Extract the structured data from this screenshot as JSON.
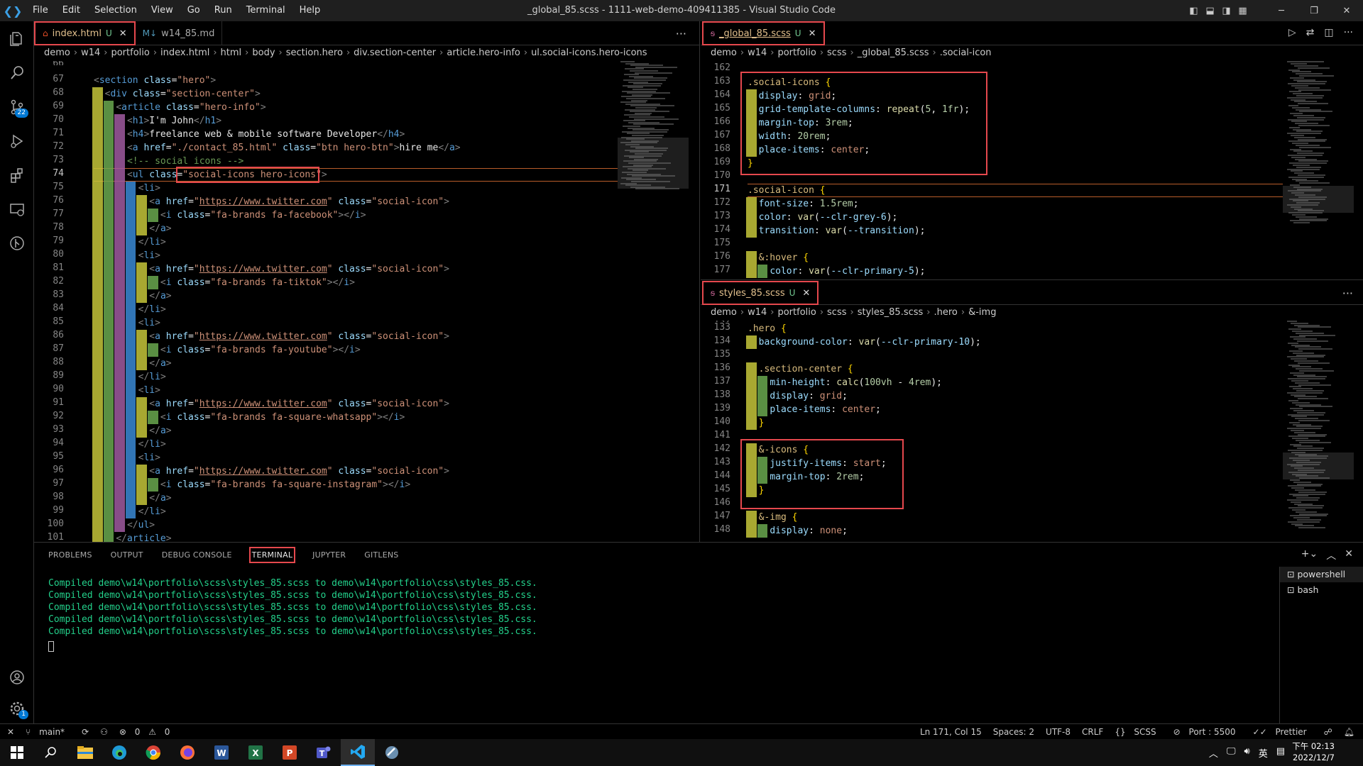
{
  "window": {
    "title": "_global_85.scss - 1111-web-demo-409411385 - Visual Studio Code",
    "menu": [
      "File",
      "Edit",
      "Selection",
      "View",
      "Go",
      "Run",
      "Terminal",
      "Help"
    ]
  },
  "activity_icons": [
    "explorer-icon",
    "search-icon",
    "source-control-icon",
    "run-debug-icon",
    "extensions-icon",
    "remote-explorer-icon",
    "gitlens-icon"
  ],
  "source_control_badge": "22",
  "settings_badge": "1",
  "left_editor": {
    "tabs": [
      {
        "label": "index.html",
        "status": "U",
        "icon": "html-icon",
        "active": true
      },
      {
        "label": "w14_85.md",
        "status": "",
        "icon": "markdown-icon",
        "active": false
      }
    ],
    "breadcrumb": [
      "demo",
      "w14",
      "portfolio",
      "index.html",
      "html",
      "body",
      "section.hero",
      "div.section-center",
      "article.hero-info",
      "ul.social-icons.hero-icons"
    ],
    "first_partial_line": "66",
    "current_line": 74,
    "lines": [
      {
        "n": "67",
        "html": "<span class='pn'>&lt;</span><span class='tag'>section</span> <span class='an'>class</span><span class='tx'>=</span><span class='av'>\"hero\"</span><span class='pn'>&gt;</span>"
      },
      {
        "n": "68",
        "html": "  <span class='pn'>&lt;</span><span class='tag'>div</span> <span class='an'>class</span><span class='tx'>=</span><span class='av'>\"section-center\"</span><span class='pn'>&gt;</span>"
      },
      {
        "n": "69",
        "html": "    <span class='pn'>&lt;</span><span class='tag'>article</span> <span class='an'>class</span><span class='tx'>=</span><span class='av'>\"hero-info\"</span><span class='pn'>&gt;</span>"
      },
      {
        "n": "70",
        "html": "      <span class='pn'>&lt;</span><span class='tag'>h1</span><span class='pn'>&gt;</span><span class='tx'>I'm John</span><span class='pn'>&lt;/</span><span class='tag'>h1</span><span class='pn'>&gt;</span>"
      },
      {
        "n": "71",
        "html": "      <span class='pn'>&lt;</span><span class='tag'>h4</span><span class='pn'>&gt;</span><span class='tx'>freelance web &amp; mobile software Developer</span><span class='pn'>&lt;/</span><span class='tag'>h4</span><span class='pn'>&gt;</span>"
      },
      {
        "n": "72",
        "html": "      <span class='pn'>&lt;</span><span class='tag'>a</span> <span class='an'>href</span><span class='tx'>=</span><span class='av'>\"./contact_85.html\"</span> <span class='an'>class</span><span class='tx'>=</span><span class='av'>\"btn hero-btn\"</span><span class='pn'>&gt;</span><span class='tx'>hire me</span><span class='pn'>&lt;/</span><span class='tag'>a</span><span class='pn'>&gt;</span>"
      },
      {
        "n": "73",
        "html": "      <span class='cm'>&lt;!-- social icons --&gt;</span>"
      },
      {
        "n": "74",
        "html": "      <span class='pn'>&lt;</span><span class='tag'>ul</span> <span class='an'>class</span><span class='tx'>=</span><span class='av'>\"social-icons hero-icons\"</span><span class='pn'>&gt;</span>"
      },
      {
        "n": "75",
        "html": "        <span class='pn'>&lt;</span><span class='tag'>li</span><span class='pn'>&gt;</span>"
      },
      {
        "n": "76",
        "html": "          <span class='pn'>&lt;</span><span class='tag'>a</span> <span class='an'>href</span><span class='tx'>=</span><span class='av'>\"</span><span class='url'>https://www.twitter.com</span><span class='av'>\"</span> <span class='an'>class</span><span class='tx'>=</span><span class='av'>\"social-icon\"</span><span class='pn'>&gt;</span>"
      },
      {
        "n": "77",
        "html": "            <span class='pn'>&lt;</span><span class='tag'>i</span> <span class='an'>class</span><span class='tx'>=</span><span class='av'>\"fa-brands fa-facebook\"</span><span class='pn'>&gt;&lt;/</span><span class='tag'>i</span><span class='pn'>&gt;</span>"
      },
      {
        "n": "78",
        "html": "          <span class='pn'>&lt;/</span><span class='tag'>a</span><span class='pn'>&gt;</span>"
      },
      {
        "n": "79",
        "html": "        <span class='pn'>&lt;/</span><span class='tag'>li</span><span class='pn'>&gt;</span>"
      },
      {
        "n": "80",
        "html": "        <span class='pn'>&lt;</span><span class='tag'>li</span><span class='pn'>&gt;</span>"
      },
      {
        "n": "81",
        "html": "          <span class='pn'>&lt;</span><span class='tag'>a</span> <span class='an'>href</span><span class='tx'>=</span><span class='av'>\"</span><span class='url'>https://www.twitter.com</span><span class='av'>\"</span> <span class='an'>class</span><span class='tx'>=</span><span class='av'>\"social-icon\"</span><span class='pn'>&gt;</span>"
      },
      {
        "n": "82",
        "html": "            <span class='pn'>&lt;</span><span class='tag'>i</span> <span class='an'>class</span><span class='tx'>=</span><span class='av'>\"fa-brands fa-tiktok\"</span><span class='pn'>&gt;&lt;/</span><span class='tag'>i</span><span class='pn'>&gt;</span>"
      },
      {
        "n": "83",
        "html": "          <span class='pn'>&lt;/</span><span class='tag'>a</span><span class='pn'>&gt;</span>"
      },
      {
        "n": "84",
        "html": "        <span class='pn'>&lt;/</span><span class='tag'>li</span><span class='pn'>&gt;</span>"
      },
      {
        "n": "85",
        "html": "        <span class='pn'>&lt;</span><span class='tag'>li</span><span class='pn'>&gt;</span>"
      },
      {
        "n": "86",
        "html": "          <span class='pn'>&lt;</span><span class='tag'>a</span> <span class='an'>href</span><span class='tx'>=</span><span class='av'>\"</span><span class='url'>https://www.twitter.com</span><span class='av'>\"</span> <span class='an'>class</span><span class='tx'>=</span><span class='av'>\"social-icon\"</span><span class='pn'>&gt;</span>"
      },
      {
        "n": "87",
        "html": "            <span class='pn'>&lt;</span><span class='tag'>i</span> <span class='an'>class</span><span class='tx'>=</span><span class='av'>\"fa-brands fa-youtube\"</span><span class='pn'>&gt;&lt;/</span><span class='tag'>i</span><span class='pn'>&gt;</span>"
      },
      {
        "n": "88",
        "html": "          <span class='pn'>&lt;/</span><span class='tag'>a</span><span class='pn'>&gt;</span>"
      },
      {
        "n": "89",
        "html": "        <span class='pn'>&lt;/</span><span class='tag'>li</span><span class='pn'>&gt;</span>"
      },
      {
        "n": "90",
        "html": "        <span class='pn'>&lt;</span><span class='tag'>li</span><span class='pn'>&gt;</span>"
      },
      {
        "n": "91",
        "html": "          <span class='pn'>&lt;</span><span class='tag'>a</span> <span class='an'>href</span><span class='tx'>=</span><span class='av'>\"</span><span class='url'>https://www.twitter.com</span><span class='av'>\"</span> <span class='an'>class</span><span class='tx'>=</span><span class='av'>\"social-icon\"</span><span class='pn'>&gt;</span>"
      },
      {
        "n": "92",
        "html": "            <span class='pn'>&lt;</span><span class='tag'>i</span> <span class='an'>class</span><span class='tx'>=</span><span class='av'>\"fa-brands fa-square-whatsapp\"</span><span class='pn'>&gt;&lt;/</span><span class='tag'>i</span><span class='pn'>&gt;</span>"
      },
      {
        "n": "93",
        "html": "          <span class='pn'>&lt;/</span><span class='tag'>a</span><span class='pn'>&gt;</span>"
      },
      {
        "n": "94",
        "html": "        <span class='pn'>&lt;/</span><span class='tag'>li</span><span class='pn'>&gt;</span>"
      },
      {
        "n": "95",
        "html": "        <span class='pn'>&lt;</span><span class='tag'>li</span><span class='pn'>&gt;</span>"
      },
      {
        "n": "96",
        "html": "          <span class='pn'>&lt;</span><span class='tag'>a</span> <span class='an'>href</span><span class='tx'>=</span><span class='av'>\"</span><span class='url'>https://www.twitter.com</span><span class='av'>\"</span> <span class='an'>class</span><span class='tx'>=</span><span class='av'>\"social-icon\"</span><span class='pn'>&gt;</span>"
      },
      {
        "n": "97",
        "html": "            <span class='pn'>&lt;</span><span class='tag'>i</span> <span class='an'>class</span><span class='tx'>=</span><span class='av'>\"fa-brands fa-square-instagram\"</span><span class='pn'>&gt;&lt;/</span><span class='tag'>i</span><span class='pn'>&gt;</span>"
      },
      {
        "n": "98",
        "html": "          <span class='pn'>&lt;/</span><span class='tag'>a</span><span class='pn'>&gt;</span>"
      },
      {
        "n": "99",
        "html": "        <span class='pn'>&lt;/</span><span class='tag'>li</span><span class='pn'>&gt;</span>"
      },
      {
        "n": "100",
        "html": "      <span class='pn'>&lt;/</span><span class='tag'>ul</span><span class='pn'>&gt;</span>"
      },
      {
        "n": "101",
        "html": "    <span class='pn'>&lt;/</span><span class='tag'>article</span><span class='pn'>&gt;</span>"
      }
    ]
  },
  "right_top_editor": {
    "tab": {
      "label": "_global_85.scss",
      "status": "U",
      "icon": "sass-icon"
    },
    "breadcrumb": [
      "demo",
      "w14",
      "portfolio",
      "scss",
      "_global_85.scss",
      ".social-icon"
    ],
    "current_line": 171,
    "lines": [
      {
        "n": "162",
        "html": ""
      },
      {
        "n": "163",
        "html": "<span class='sel'>.social-icons</span> <span class='br'>{</span>"
      },
      {
        "n": "164",
        "html": "  <span class='pr'>display</span><span class='tx'>: </span><span class='kw'>grid</span><span class='tx'>;</span>"
      },
      {
        "n": "165",
        "html": "  <span class='pr'>grid-template-columns</span><span class='tx'>: </span><span class='fn'>repeat</span><span class='tx'>(</span><span class='nu'>5</span><span class='tx'>, </span><span class='nu'>1fr</span><span class='tx'>);</span>"
      },
      {
        "n": "166",
        "html": "  <span class='pr'>margin-top</span><span class='tx'>: </span><span class='nu'>3rem</span><span class='tx'>;</span>"
      },
      {
        "n": "167",
        "html": "  <span class='pr'>width</span><span class='tx'>: </span><span class='nu'>20rem</span><span class='tx'>;</span>"
      },
      {
        "n": "168",
        "html": "  <span class='pr'>place-items</span><span class='tx'>: </span><span class='kw'>center</span><span class='tx'>;</span>"
      },
      {
        "n": "169",
        "html": "<span class='br'>}</span>"
      },
      {
        "n": "170",
        "html": ""
      },
      {
        "n": "171",
        "html": "<span class='sel'>.social-icon</span> <span class='br'>{</span>"
      },
      {
        "n": "172",
        "html": "  <span class='pr'>font-size</span><span class='tx'>: </span><span class='nu'>1.5rem</span><span class='tx'>;</span>"
      },
      {
        "n": "173",
        "html": "  <span class='pr'>color</span><span class='tx'>: </span><span class='fn'>var</span><span class='tx'>(</span><span class='pr'>--clr-grey-6</span><span class='tx'>);</span>"
      },
      {
        "n": "174",
        "html": "  <span class='pr'>transition</span><span class='tx'>: </span><span class='fn'>var</span><span class='tx'>(</span><span class='pr'>--transition</span><span class='tx'>);</span>"
      },
      {
        "n": "175",
        "html": ""
      },
      {
        "n": "176",
        "html": "  <span class='sel'>&amp;:hover</span> <span class='br'>{</span>"
      },
      {
        "n": "177",
        "html": "    <span class='pr'>color</span><span class='tx'>: </span><span class='fn'>var</span><span class='tx'>(</span><span class='pr'>--clr-primary-5</span><span class='tx'>);</span>"
      }
    ]
  },
  "right_bottom_editor": {
    "tab": {
      "label": "styles_85.scss",
      "status": "U",
      "icon": "sass-icon"
    },
    "breadcrumb": [
      "demo",
      "w14",
      "portfolio",
      "scss",
      "styles_85.scss",
      ".hero",
      "&-img"
    ],
    "lines": [
      {
        "n": "133",
        "html": "<span class='sel'>.hero</span> <span class='br'>{</span>"
      },
      {
        "n": "134",
        "html": "  <span class='pr'>background-color</span><span class='tx'>: </span><span class='fn'>var</span><span class='tx'>(</span><span class='pr'>--clr-primary-10</span><span class='tx'>);</span>"
      },
      {
        "n": "135",
        "html": ""
      },
      {
        "n": "136",
        "html": "  <span class='sel'>.section-center</span> <span class='br'>{</span>"
      },
      {
        "n": "137",
        "html": "    <span class='pr'>min-height</span><span class='tx'>: </span><span class='fn'>calc</span><span class='tx'>(</span><span class='nu'>100vh</span><span class='tx'> - </span><span class='nu'>4rem</span><span class='tx'>);</span>"
      },
      {
        "n": "138",
        "html": "    <span class='pr'>display</span><span class='tx'>: </span><span class='kw'>grid</span><span class='tx'>;</span>"
      },
      {
        "n": "139",
        "html": "    <span class='pr'>place-items</span><span class='tx'>: </span><span class='kw'>center</span><span class='tx'>;</span>"
      },
      {
        "n": "140",
        "html": "  <span class='br'>}</span>"
      },
      {
        "n": "141",
        "html": ""
      },
      {
        "n": "142",
        "html": "  <span class='sel'>&amp;-icons</span> <span class='br'>{</span>"
      },
      {
        "n": "143",
        "html": "    <span class='pr'>justify-items</span><span class='tx'>: </span><span class='kw'>start</span><span class='tx'>;</span>"
      },
      {
        "n": "144",
        "html": "    <span class='pr'>margin-top</span><span class='tx'>: </span><span class='nu'>2rem</span><span class='tx'>;</span>"
      },
      {
        "n": "145",
        "html": "  <span class='br'>}</span>"
      },
      {
        "n": "146",
        "html": ""
      },
      {
        "n": "147",
        "html": "  <span class='sel'>&amp;-img</span> <span class='br'>{</span>"
      },
      {
        "n": "148",
        "html": "    <span class='pr'>display</span><span class='tx'>: </span><span class='kw'>none</span><span class='tx'>;</span>"
      }
    ]
  },
  "panel": {
    "tabs": [
      "PROBLEMS",
      "OUTPUT",
      "DEBUG CONSOLE",
      "TERMINAL",
      "JUPYTER",
      "GITLENS"
    ],
    "active_tab": "TERMINAL",
    "terminal_lines": [
      "Compiled demo\\w14\\portfolio\\scss\\styles_85.scss to demo\\w14\\portfolio\\css\\styles_85.css.",
      "Compiled demo\\w14\\portfolio\\scss\\styles_85.scss to demo\\w14\\portfolio\\css\\styles_85.css.",
      "Compiled demo\\w14\\portfolio\\scss\\styles_85.scss to demo\\w14\\portfolio\\css\\styles_85.css.",
      "Compiled demo\\w14\\portfolio\\scss\\styles_85.scss to demo\\w14\\portfolio\\css\\styles_85.css.",
      "Compiled demo\\w14\\portfolio\\scss\\styles_85.scss to demo\\w14\\portfolio\\css\\styles_85.css."
    ],
    "terminals": [
      "powershell",
      "bash"
    ]
  },
  "status_bar": {
    "branch": "main*",
    "problems": "0",
    "warnings": "0",
    "position": "Ln 171, Col 15",
    "spaces": "Spaces: 2",
    "encoding": "UTF-8",
    "eol": "CRLF",
    "language": "SCSS",
    "port": "Port : 5500",
    "prettier": "Prettier"
  },
  "taskbar": {
    "apps": [
      "windows-start-icon",
      "search-icon",
      "file-explorer-icon",
      "edge-icon",
      "chrome-icon",
      "firefox-icon",
      "word-icon",
      "excel-icon",
      "powerpoint-icon",
      "teams-icon",
      "vscode-icon",
      "tool-icon"
    ],
    "active_app": "vscode-icon",
    "time": "下午 02:13",
    "date": "2022/12/7",
    "ime": "英"
  },
  "colors": {
    "highlight_box": "#e5484d",
    "terminal_text": "#23d18b",
    "indent_1": "#c5c539",
    "indent_2": "#6aa84f",
    "indent_3": "#a05aa0",
    "indent_4": "#3a8ad6"
  }
}
